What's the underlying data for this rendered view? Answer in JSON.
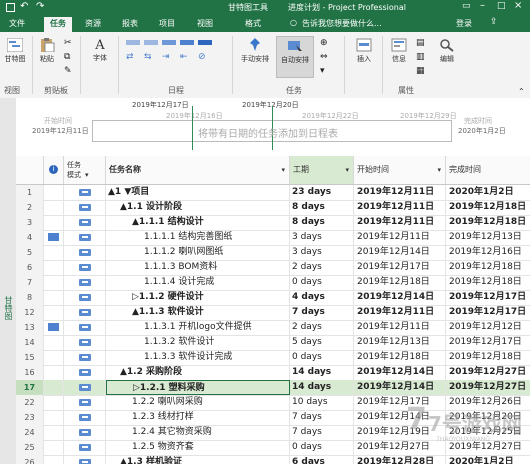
{
  "titlebar": {
    "tool_context": "甘特图工具",
    "title": "进度计划 - Project Professional"
  },
  "tabs": [
    {
      "label": "文件"
    },
    {
      "label": "任务",
      "active": true
    },
    {
      "label": "资源"
    },
    {
      "label": "报表"
    },
    {
      "label": "项目"
    },
    {
      "label": "视图"
    },
    {
      "label": "格式"
    }
  ],
  "tell_me": "告诉我您想要做什么...",
  "signin": "登录",
  "ribbon": {
    "gantt_button": "甘特图",
    "paste_button": "粘贴",
    "font_button": "字体",
    "manual_schedule": "手动安排",
    "auto_schedule": "自动安排",
    "insert_button": "插入",
    "info_button": "信息",
    "edit_button": "编辑",
    "groups": {
      "view": "视图",
      "clipboard": "剪贴板",
      "schedule": "日程",
      "tasks": "任务",
      "properties": "属性"
    }
  },
  "timeline": {
    "start_label": "开始时间",
    "start_date": "2019年12月11日",
    "end_label": "完成时间",
    "end_date": "2020年1月2日",
    "placeholder": "将带有日期的任务添加到日程表",
    "dates": [
      "2019年12月17日",
      "2019年12月20日",
      "2019年12月16日",
      "2019年12月22日",
      "2019年12月29日"
    ]
  },
  "sidebar_label": "甘特图",
  "columns": {
    "mode": "任务模式",
    "name": "任务名称",
    "duration": "工期",
    "start": "开始时间",
    "finish": "完成时间"
  },
  "rows": [
    {
      "id": "1",
      "name": "▲1 ▼项目",
      "indent": 0,
      "bold": true,
      "duration": "23 days",
      "start": "2019年12月11日",
      "finish": "2020年1月2日"
    },
    {
      "id": "2",
      "name": "▲1.1 设计阶段",
      "indent": 1,
      "bold": true,
      "duration": "8 days",
      "start": "2019年12月11日",
      "finish": "2019年12月18日"
    },
    {
      "id": "3",
      "name": "▲1.1.1 结构设计",
      "indent": 2,
      "bold": true,
      "duration": "8 days",
      "start": "2019年12月11日",
      "finish": "2019年12月18日"
    },
    {
      "id": "4",
      "name": "1.1.1.1 结构完善图纸",
      "indent": 3,
      "bold": false,
      "duration": "3 days",
      "start": "2019年12月11日",
      "finish": "2019年12月13日",
      "note": true
    },
    {
      "id": "5",
      "name": "1.1.1.2 喇叭网图纸",
      "indent": 3,
      "bold": false,
      "duration": "3 days",
      "start": "2019年12月14日",
      "finish": "2019年12月16日"
    },
    {
      "id": "6",
      "name": "1.1.1.3 BOM资料",
      "indent": 3,
      "bold": false,
      "duration": "2 days",
      "start": "2019年12月17日",
      "finish": "2019年12月18日"
    },
    {
      "id": "7",
      "name": "1.1.1.4 设计完成",
      "indent": 3,
      "bold": false,
      "duration": "0 days",
      "start": "2019年12月18日",
      "finish": "2019年12月18日"
    },
    {
      "id": "8",
      "name": "▷1.1.2 硬件设计",
      "indent": 2,
      "bold": true,
      "duration": "4 days",
      "start": "2019年12月14日",
      "finish": "2019年12月17日"
    },
    {
      "id": "12",
      "name": "▲1.1.3 软件设计",
      "indent": 2,
      "bold": true,
      "duration": "7 days",
      "start": "2019年12月11日",
      "finish": "2019年12月17日"
    },
    {
      "id": "13",
      "name": "1.1.3.1 开机logo文件提供",
      "indent": 3,
      "bold": false,
      "duration": "2 days",
      "start": "2019年12月11日",
      "finish": "2019年12月12日",
      "note": true
    },
    {
      "id": "14",
      "name": "1.1.3.2 软件设计",
      "indent": 3,
      "bold": false,
      "duration": "5 days",
      "start": "2019年12月13日",
      "finish": "2019年12月17日"
    },
    {
      "id": "15",
      "name": "1.1.3.3 软件设计完成",
      "indent": 3,
      "bold": false,
      "duration": "0 days",
      "start": "2019年12月18日",
      "finish": "2019年12月18日"
    },
    {
      "id": "16",
      "name": "▲1.2 采购阶段",
      "indent": 1,
      "bold": true,
      "duration": "14 days",
      "start": "2019年12月14日",
      "finish": "2019年12月27日"
    },
    {
      "id": "17",
      "name": "▷1.2.1 塑料采购",
      "indent": 2,
      "bold": true,
      "duration": "14 days",
      "start": "2019年12月14日",
      "finish": "2019年12月27日",
      "selected": true
    },
    {
      "id": "22",
      "name": "1.2.2 喇叭网采购",
      "indent": 2,
      "bold": false,
      "duration": "10 days",
      "start": "2019年12月17日",
      "finish": "2019年12月26日"
    },
    {
      "id": "23",
      "name": "1.2.3 线材打样",
      "indent": 2,
      "bold": false,
      "duration": "7 days",
      "start": "2019年12月14日",
      "finish": "2019年12月20日"
    },
    {
      "id": "24",
      "name": "1.2.4 其它物资采购",
      "indent": 2,
      "bold": false,
      "duration": "7 days",
      "start": "2019年12月19日",
      "finish": "2019年12月25日"
    },
    {
      "id": "25",
      "name": "1.2.5 物资齐套",
      "indent": 2,
      "bold": false,
      "duration": "0 days",
      "start": "2019年12月27日",
      "finish": "2019年12月27日"
    },
    {
      "id": "26",
      "name": "▲1.3 样机验证",
      "indent": 1,
      "bold": true,
      "duration": "6 days",
      "start": "2019年12月28日",
      "finish": "2020年1月2日"
    }
  ],
  "watermark": {
    "text": "7号游戏网",
    "sub": "7HAOYOUXIWANG"
  },
  "colors": {
    "accent": "#217346",
    "selected_row": "#d9ead3",
    "mode_icon": "#5b8bd0"
  }
}
